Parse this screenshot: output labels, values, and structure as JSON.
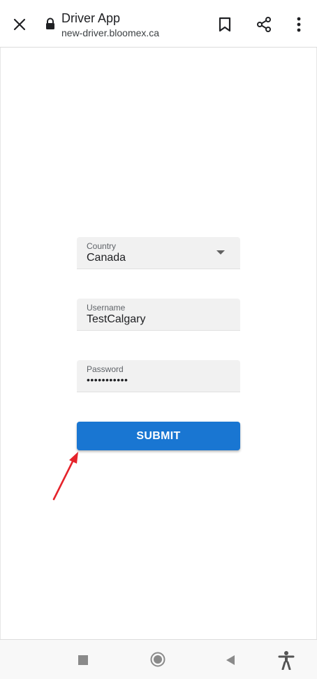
{
  "browser": {
    "title": "Driver App",
    "url": "new-driver.bloomex.ca"
  },
  "form": {
    "country": {
      "label": "Country",
      "value": "Canada"
    },
    "username": {
      "label": "Username",
      "value": "TestCalgary"
    },
    "password": {
      "label": "Password",
      "value": "•••••••••••"
    },
    "submit_label": "SUBMIT"
  },
  "colors": {
    "submit_button": "#1976d2",
    "annotation_arrow": "#e5232b",
    "field_background": "#f1f1f1"
  },
  "icons": {
    "close": "close-icon",
    "lock": "lock-icon",
    "bookmark": "bookmark-icon",
    "share": "share-icon",
    "more": "more-vertical-icon",
    "dropdown": "dropdown-arrow-icon",
    "nav_recents": "recents-square-icon",
    "nav_home": "home-circle-icon",
    "nav_back": "back-triangle-icon",
    "nav_accessibility": "accessibility-icon"
  }
}
